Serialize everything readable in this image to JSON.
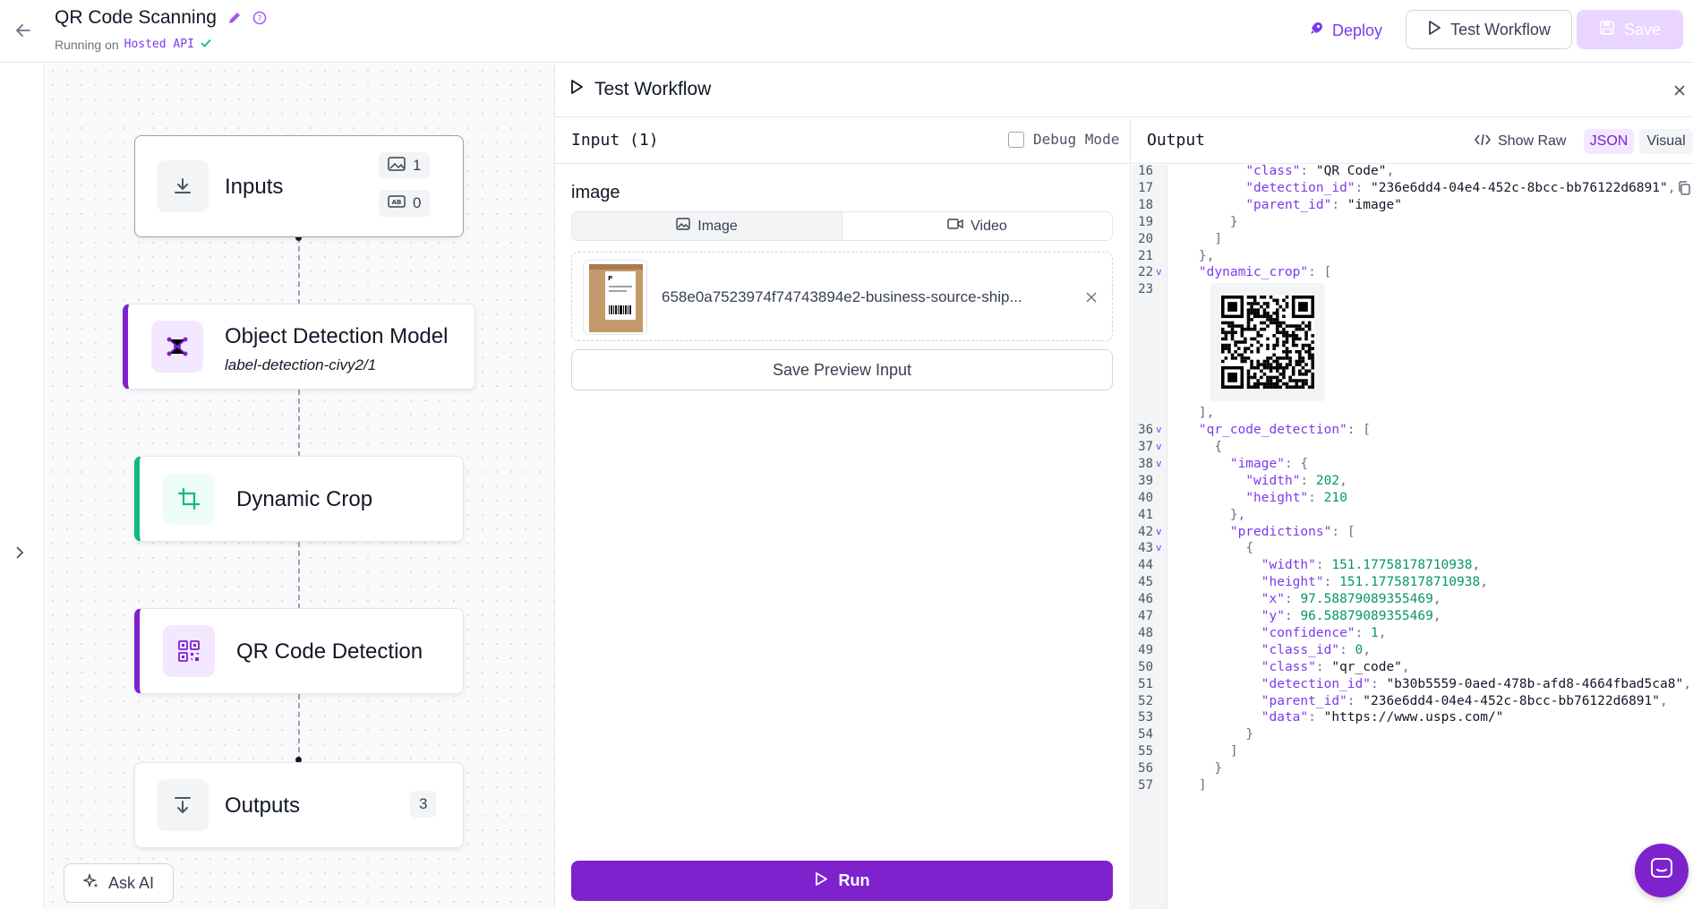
{
  "header": {
    "title": "QR Code Scanning",
    "running_prefix": "Running on",
    "running_target": "Hosted API",
    "deploy_label": "Deploy",
    "test_label": "Test Workflow",
    "save_label": "Save"
  },
  "canvas": {
    "nodes": {
      "inputs": {
        "label": "Inputs",
        "image_count": "1",
        "param_count": "0"
      },
      "detection": {
        "label": "Object Detection Model",
        "model": "label-detection-civy2/1"
      },
      "crop": {
        "label": "Dynamic Crop"
      },
      "qr": {
        "label": "QR Code Detection"
      },
      "outputs": {
        "label": "Outputs",
        "count": "3"
      }
    },
    "ask_ai_label": "Ask AI",
    "colors": {
      "detection_accent": "#7e22ce",
      "crop_accent": "#10b981",
      "qr_accent": "#7e22ce"
    }
  },
  "panel": {
    "title": "Test Workflow",
    "input": {
      "title": "Input (1)",
      "debug_label": "Debug Mode",
      "field_label": "image",
      "tabs": [
        "Image",
        "Video"
      ],
      "file_name": "658e0a7523974f74743894e2-business-source-ship...",
      "save_preview_label": "Save Preview Input",
      "run_label": "Run"
    },
    "output": {
      "title": "Output",
      "show_raw_label": "Show Raw",
      "tabs": [
        "JSON",
        "Visual"
      ],
      "lines": [
        {
          "n": "16",
          "fold": false,
          "text": "          \"class\": \"QR Code\","
        },
        {
          "n": "17",
          "fold": false,
          "text": "          \"detection_id\": \"236e6dd4-04e4-452c-8bcc-bb76122d6891\","
        },
        {
          "n": "18",
          "fold": false,
          "text": "          \"parent_id\": \"image\""
        },
        {
          "n": "19",
          "fold": false,
          "text": "        }"
        },
        {
          "n": "20",
          "fold": false,
          "text": "      ]"
        },
        {
          "n": "21",
          "fold": false,
          "text": "    },"
        },
        {
          "n": "22",
          "fold": true,
          "text": "    \"dynamic_crop\": ["
        },
        {
          "n": "23",
          "fold": false,
          "text": ""
        },
        {
          "n": "",
          "fold": false,
          "text": "    ],"
        },
        {
          "n": "36",
          "fold": true,
          "text": "    \"qr_code_detection\": ["
        },
        {
          "n": "37",
          "fold": true,
          "text": "      {"
        },
        {
          "n": "38",
          "fold": true,
          "text": "        \"image\": {"
        },
        {
          "n": "39",
          "fold": false,
          "text": "          \"width\": 202,"
        },
        {
          "n": "40",
          "fold": false,
          "text": "          \"height\": 210"
        },
        {
          "n": "41",
          "fold": false,
          "text": "        },"
        },
        {
          "n": "42",
          "fold": true,
          "text": "        \"predictions\": ["
        },
        {
          "n": "43",
          "fold": true,
          "text": "          {"
        },
        {
          "n": "44",
          "fold": false,
          "text": "            \"width\": 151.17758178710938,"
        },
        {
          "n": "45",
          "fold": false,
          "text": "            \"height\": 151.17758178710938,"
        },
        {
          "n": "46",
          "fold": false,
          "text": "            \"x\": 97.58879089355469,"
        },
        {
          "n": "47",
          "fold": false,
          "text": "            \"y\": 96.58879089355469,"
        },
        {
          "n": "48",
          "fold": false,
          "text": "            \"confidence\": 1,"
        },
        {
          "n": "49",
          "fold": false,
          "text": "            \"class_id\": 0,"
        },
        {
          "n": "50",
          "fold": false,
          "text": "            \"class\": \"qr_code\","
        },
        {
          "n": "51",
          "fold": false,
          "text": "            \"detection_id\": \"b30b5559-0aed-478b-afd8-4664fbad5ca8\","
        },
        {
          "n": "52",
          "fold": false,
          "text": "            \"parent_id\": \"236e6dd4-04e4-452c-8bcc-bb76122d6891\","
        },
        {
          "n": "53",
          "fold": false,
          "text": "            \"data\": \"https://www.usps.com/\""
        },
        {
          "n": "54",
          "fold": false,
          "text": "          }"
        },
        {
          "n": "55",
          "fold": false,
          "text": "        ]"
        },
        {
          "n": "56",
          "fold": false,
          "text": "      }"
        },
        {
          "n": "57",
          "fold": false,
          "text": "    ]"
        }
      ]
    }
  },
  "colors": {
    "accent": "#7e22ce",
    "accent_light": "#f3e8ff",
    "save_disabled": "#e9d5ff"
  }
}
